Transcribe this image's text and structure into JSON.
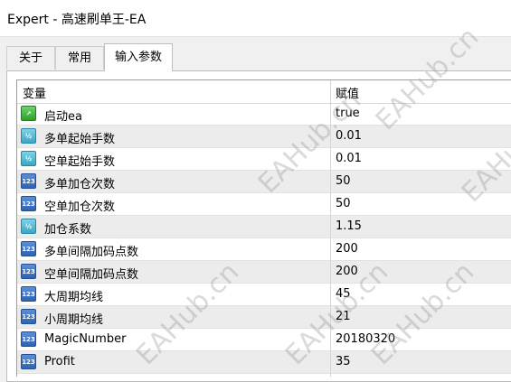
{
  "window": {
    "title": "Expert - 高速刷单王-EA"
  },
  "tabs": [
    {
      "label": "关于"
    },
    {
      "label": "常用"
    },
    {
      "label": "输入参数"
    }
  ],
  "grid": {
    "headers": {
      "variable": "变量",
      "value": "赋值"
    },
    "rows": [
      {
        "name": "启动ea",
        "value": "true",
        "type": "bool",
        "icon": "toggle-icon"
      },
      {
        "name": "多单起始手数",
        "value": "0.01",
        "type": "double",
        "icon": "half-icon"
      },
      {
        "name": "空单起始手数",
        "value": "0.01",
        "type": "double",
        "icon": "half-icon"
      },
      {
        "name": "多单加仓次数",
        "value": "50",
        "type": "int",
        "icon": "123-icon"
      },
      {
        "name": "空单加仓次数",
        "value": "50",
        "type": "int",
        "icon": "123-icon"
      },
      {
        "name": "加仓系数",
        "value": "1.15",
        "type": "double",
        "icon": "half-icon"
      },
      {
        "name": "多单间隔加码点数",
        "value": "200",
        "type": "int",
        "icon": "123-icon"
      },
      {
        "name": "空单间隔加码点数",
        "value": "200",
        "type": "int",
        "icon": "123-icon"
      },
      {
        "name": "大周期均线",
        "value": "45",
        "type": "int",
        "icon": "123-icon"
      },
      {
        "name": "小周期均线",
        "value": "21",
        "type": "int",
        "icon": "123-icon"
      },
      {
        "name": "MagicNumber",
        "value": "20180320",
        "type": "int",
        "icon": "123-icon"
      },
      {
        "name": "Profit",
        "value": "35",
        "type": "int",
        "icon": "123-icon"
      }
    ]
  },
  "icon_glyphs": {
    "int": "123",
    "double": "½",
    "bool": "↗"
  },
  "watermark": "EAHub.cn"
}
